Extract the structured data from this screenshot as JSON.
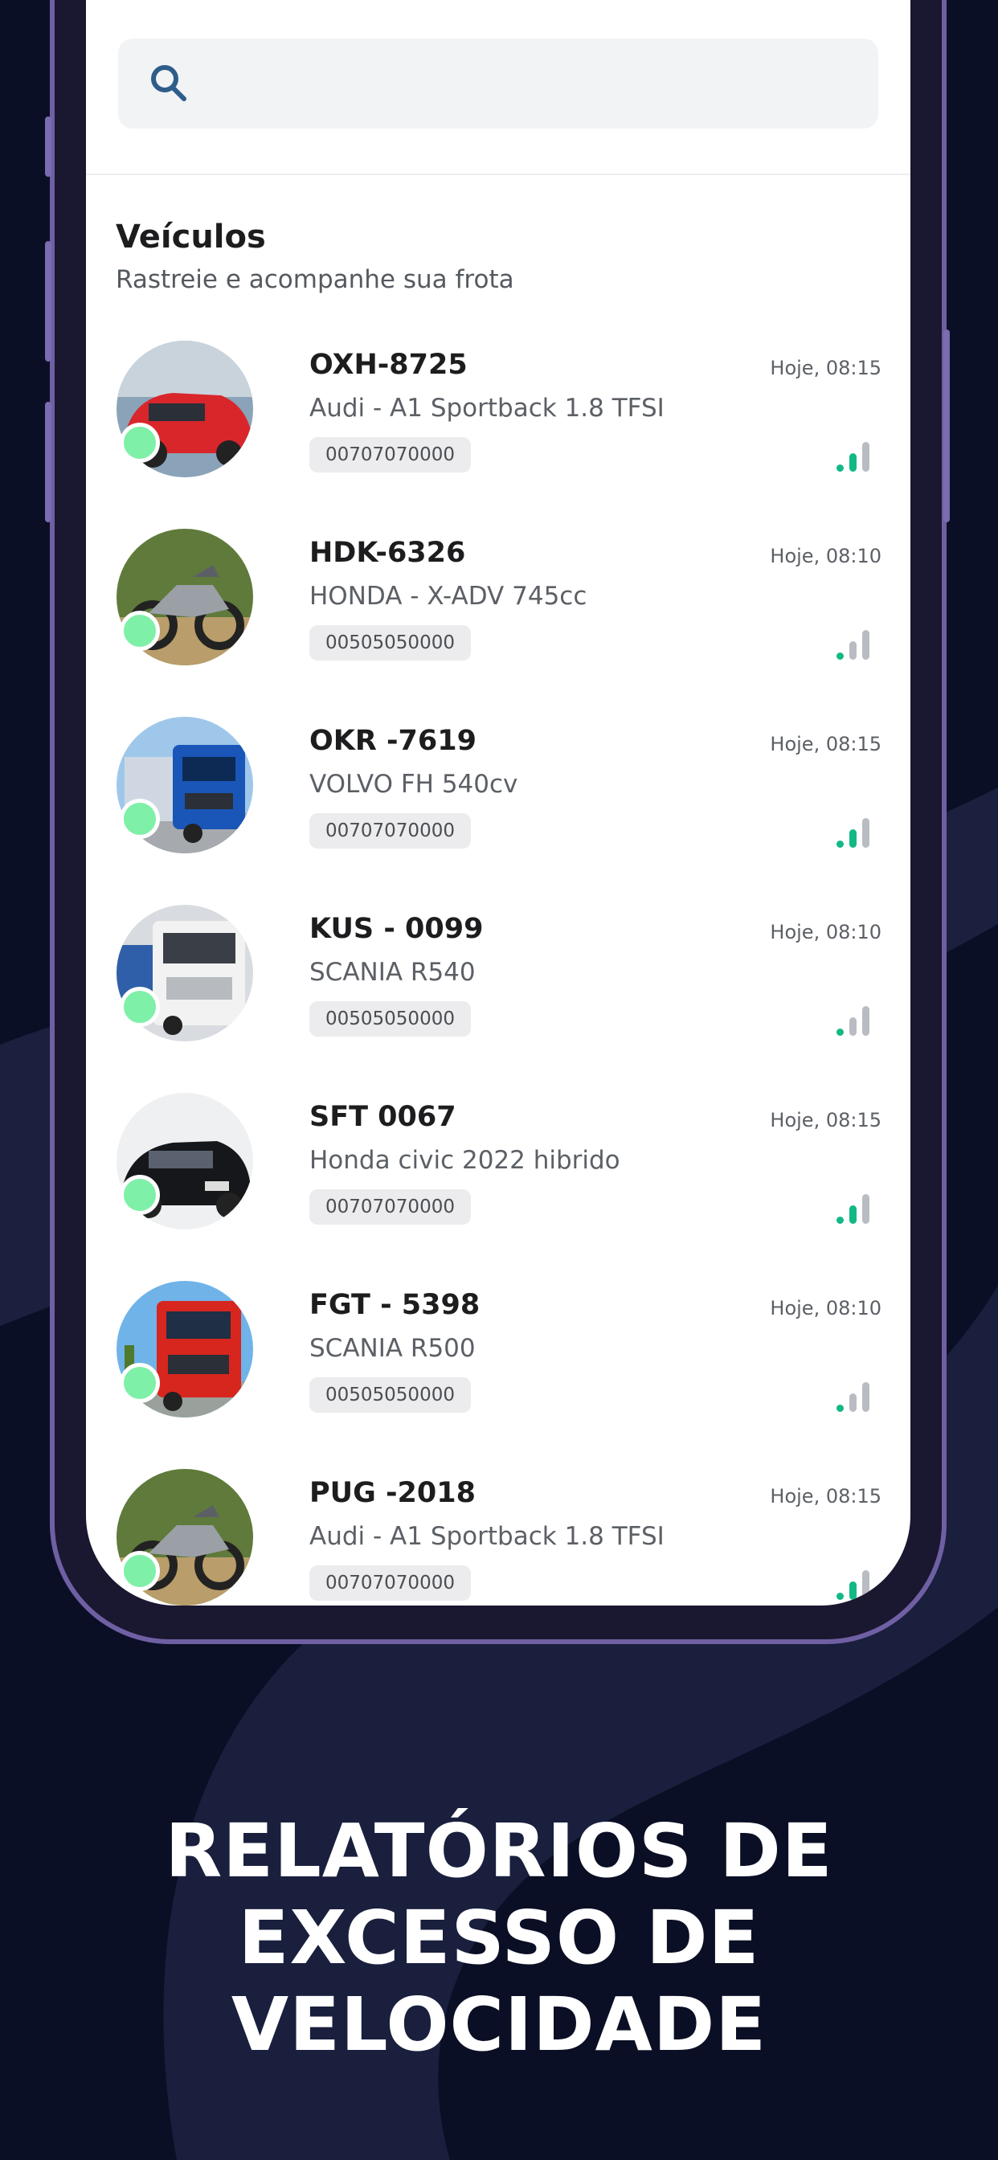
{
  "search": {
    "placeholder": ""
  },
  "section": {
    "title": "Veículos",
    "subtitle": "Rastreie e acompanhe sua frota"
  },
  "vehicles": [
    {
      "plate": "OXH-8725",
      "model": "Audi - A1 Sportback 1.8 TFSI",
      "imei": "00707070000",
      "time": "Hoje, 08:15",
      "signal_level": 2,
      "thumb": "red-car"
    },
    {
      "plate": "HDK-6326",
      "model": "HONDA - X-ADV 745cc",
      "imei": "00505050000",
      "time": "Hoje, 08:10",
      "signal_level": 1,
      "thumb": "motorcycle"
    },
    {
      "plate": "OKR -7619",
      "model": "VOLVO FH 540cv",
      "imei": "00707070000",
      "time": "Hoje, 08:15",
      "signal_level": 2,
      "thumb": "blue-truck"
    },
    {
      "plate": "KUS - 0099",
      "model": "SCANIA R540",
      "imei": "00505050000",
      "time": "Hoje, 08:10",
      "signal_level": 1,
      "thumb": "white-truck"
    },
    {
      "plate": "SFT 0067",
      "model": "Honda civic 2022 hibrido",
      "imei": "00707070000",
      "time": "Hoje, 08:15",
      "signal_level": 2,
      "thumb": "black-car"
    },
    {
      "plate": "FGT - 5398",
      "model": "SCANIA R500",
      "imei": "00505050000",
      "time": "Hoje, 08:10",
      "signal_level": 1,
      "thumb": "red-truck"
    },
    {
      "plate": "PUG -2018",
      "model": "Audi - A1 Sportback 1.8 TFSI",
      "imei": "00707070000",
      "time": "Hoje, 08:15",
      "signal_level": 2,
      "thumb": "motorcycle"
    }
  ],
  "headline": {
    "line1": "RELATÓRIOS DE",
    "line2": "EXCESSO DE",
    "line3": "VELOCIDADE"
  },
  "colors": {
    "background": "#0b0f25",
    "phone_frame": "#6f5fa3",
    "status_online": "#7ef0a8",
    "signal_active": "#12b886",
    "signal_inactive": "#b9bcc2"
  }
}
